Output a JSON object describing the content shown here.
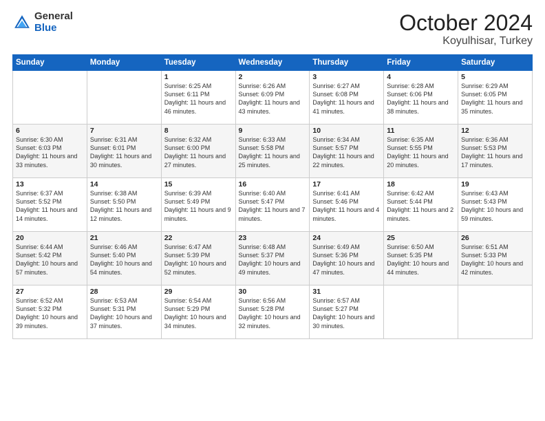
{
  "logo": {
    "general": "General",
    "blue": "Blue"
  },
  "header": {
    "month": "October 2024",
    "location": "Koyulhisar, Turkey"
  },
  "days_of_week": [
    "Sunday",
    "Monday",
    "Tuesday",
    "Wednesday",
    "Thursday",
    "Friday",
    "Saturday"
  ],
  "weeks": [
    [
      {
        "day": "",
        "sunrise": "",
        "sunset": "",
        "daylight": ""
      },
      {
        "day": "",
        "sunrise": "",
        "sunset": "",
        "daylight": ""
      },
      {
        "day": "1",
        "sunrise": "Sunrise: 6:25 AM",
        "sunset": "Sunset: 6:11 PM",
        "daylight": "Daylight: 11 hours and 46 minutes."
      },
      {
        "day": "2",
        "sunrise": "Sunrise: 6:26 AM",
        "sunset": "Sunset: 6:09 PM",
        "daylight": "Daylight: 11 hours and 43 minutes."
      },
      {
        "day": "3",
        "sunrise": "Sunrise: 6:27 AM",
        "sunset": "Sunset: 6:08 PM",
        "daylight": "Daylight: 11 hours and 41 minutes."
      },
      {
        "day": "4",
        "sunrise": "Sunrise: 6:28 AM",
        "sunset": "Sunset: 6:06 PM",
        "daylight": "Daylight: 11 hours and 38 minutes."
      },
      {
        "day": "5",
        "sunrise": "Sunrise: 6:29 AM",
        "sunset": "Sunset: 6:05 PM",
        "daylight": "Daylight: 11 hours and 35 minutes."
      }
    ],
    [
      {
        "day": "6",
        "sunrise": "Sunrise: 6:30 AM",
        "sunset": "Sunset: 6:03 PM",
        "daylight": "Daylight: 11 hours and 33 minutes."
      },
      {
        "day": "7",
        "sunrise": "Sunrise: 6:31 AM",
        "sunset": "Sunset: 6:01 PM",
        "daylight": "Daylight: 11 hours and 30 minutes."
      },
      {
        "day": "8",
        "sunrise": "Sunrise: 6:32 AM",
        "sunset": "Sunset: 6:00 PM",
        "daylight": "Daylight: 11 hours and 27 minutes."
      },
      {
        "day": "9",
        "sunrise": "Sunrise: 6:33 AM",
        "sunset": "Sunset: 5:58 PM",
        "daylight": "Daylight: 11 hours and 25 minutes."
      },
      {
        "day": "10",
        "sunrise": "Sunrise: 6:34 AM",
        "sunset": "Sunset: 5:57 PM",
        "daylight": "Daylight: 11 hours and 22 minutes."
      },
      {
        "day": "11",
        "sunrise": "Sunrise: 6:35 AM",
        "sunset": "Sunset: 5:55 PM",
        "daylight": "Daylight: 11 hours and 20 minutes."
      },
      {
        "day": "12",
        "sunrise": "Sunrise: 6:36 AM",
        "sunset": "Sunset: 5:53 PM",
        "daylight": "Daylight: 11 hours and 17 minutes."
      }
    ],
    [
      {
        "day": "13",
        "sunrise": "Sunrise: 6:37 AM",
        "sunset": "Sunset: 5:52 PM",
        "daylight": "Daylight: 11 hours and 14 minutes."
      },
      {
        "day": "14",
        "sunrise": "Sunrise: 6:38 AM",
        "sunset": "Sunset: 5:50 PM",
        "daylight": "Daylight: 11 hours and 12 minutes."
      },
      {
        "day": "15",
        "sunrise": "Sunrise: 6:39 AM",
        "sunset": "Sunset: 5:49 PM",
        "daylight": "Daylight: 11 hours and 9 minutes."
      },
      {
        "day": "16",
        "sunrise": "Sunrise: 6:40 AM",
        "sunset": "Sunset: 5:47 PM",
        "daylight": "Daylight: 11 hours and 7 minutes."
      },
      {
        "day": "17",
        "sunrise": "Sunrise: 6:41 AM",
        "sunset": "Sunset: 5:46 PM",
        "daylight": "Daylight: 11 hours and 4 minutes."
      },
      {
        "day": "18",
        "sunrise": "Sunrise: 6:42 AM",
        "sunset": "Sunset: 5:44 PM",
        "daylight": "Daylight: 11 hours and 2 minutes."
      },
      {
        "day": "19",
        "sunrise": "Sunrise: 6:43 AM",
        "sunset": "Sunset: 5:43 PM",
        "daylight": "Daylight: 10 hours and 59 minutes."
      }
    ],
    [
      {
        "day": "20",
        "sunrise": "Sunrise: 6:44 AM",
        "sunset": "Sunset: 5:42 PM",
        "daylight": "Daylight: 10 hours and 57 minutes."
      },
      {
        "day": "21",
        "sunrise": "Sunrise: 6:46 AM",
        "sunset": "Sunset: 5:40 PM",
        "daylight": "Daylight: 10 hours and 54 minutes."
      },
      {
        "day": "22",
        "sunrise": "Sunrise: 6:47 AM",
        "sunset": "Sunset: 5:39 PM",
        "daylight": "Daylight: 10 hours and 52 minutes."
      },
      {
        "day": "23",
        "sunrise": "Sunrise: 6:48 AM",
        "sunset": "Sunset: 5:37 PM",
        "daylight": "Daylight: 10 hours and 49 minutes."
      },
      {
        "day": "24",
        "sunrise": "Sunrise: 6:49 AM",
        "sunset": "Sunset: 5:36 PM",
        "daylight": "Daylight: 10 hours and 47 minutes."
      },
      {
        "day": "25",
        "sunrise": "Sunrise: 6:50 AM",
        "sunset": "Sunset: 5:35 PM",
        "daylight": "Daylight: 10 hours and 44 minutes."
      },
      {
        "day": "26",
        "sunrise": "Sunrise: 6:51 AM",
        "sunset": "Sunset: 5:33 PM",
        "daylight": "Daylight: 10 hours and 42 minutes."
      }
    ],
    [
      {
        "day": "27",
        "sunrise": "Sunrise: 6:52 AM",
        "sunset": "Sunset: 5:32 PM",
        "daylight": "Daylight: 10 hours and 39 minutes."
      },
      {
        "day": "28",
        "sunrise": "Sunrise: 6:53 AM",
        "sunset": "Sunset: 5:31 PM",
        "daylight": "Daylight: 10 hours and 37 minutes."
      },
      {
        "day": "29",
        "sunrise": "Sunrise: 6:54 AM",
        "sunset": "Sunset: 5:29 PM",
        "daylight": "Daylight: 10 hours and 34 minutes."
      },
      {
        "day": "30",
        "sunrise": "Sunrise: 6:56 AM",
        "sunset": "Sunset: 5:28 PM",
        "daylight": "Daylight: 10 hours and 32 minutes."
      },
      {
        "day": "31",
        "sunrise": "Sunrise: 6:57 AM",
        "sunset": "Sunset: 5:27 PM",
        "daylight": "Daylight: 10 hours and 30 minutes."
      },
      {
        "day": "",
        "sunrise": "",
        "sunset": "",
        "daylight": ""
      },
      {
        "day": "",
        "sunrise": "",
        "sunset": "",
        "daylight": ""
      }
    ]
  ]
}
